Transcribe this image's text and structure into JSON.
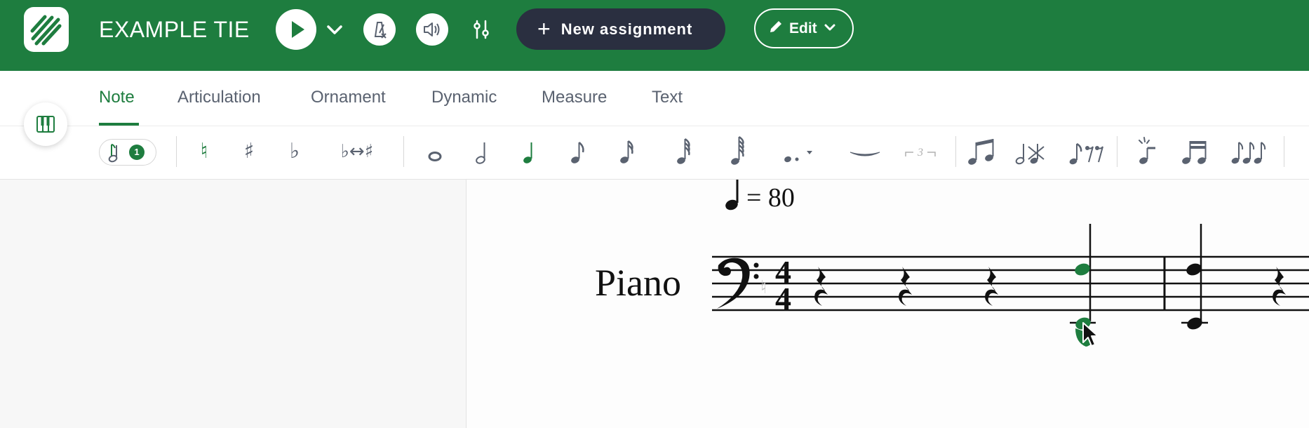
{
  "header": {
    "title": "EXAMPLE TIE",
    "new_assignment_label": "New assignment",
    "new_assignment_icon": "+",
    "edit_label": "Edit",
    "icons": [
      "app-logo-icon",
      "play-icon",
      "chevron-down-icon",
      "metronome-off-icon",
      "speaker-icon",
      "mixer-icon",
      "pencil-icon"
    ]
  },
  "tabs": [
    {
      "label": "Note",
      "active": true
    },
    {
      "label": "Articulation",
      "active": false
    },
    {
      "label": "Ornament",
      "active": false
    },
    {
      "label": "Dynamic",
      "active": false
    },
    {
      "label": "Measure",
      "active": false
    },
    {
      "label": "Text",
      "active": false
    }
  ],
  "toolbar": {
    "voice_badge": "1",
    "accidentals": [
      {
        "glyph": "♮",
        "name": "natural",
        "active": true
      },
      {
        "glyph": "♯",
        "name": "sharp",
        "active": false
      },
      {
        "glyph": "♭",
        "name": "flat",
        "active": false
      },
      {
        "glyph": "♭↔♯",
        "name": "enharmonic-swap",
        "active": false
      }
    ],
    "durations": [
      "whole",
      "half",
      "quarter",
      "eighth",
      "sixteenth",
      "thirty-second",
      "sixty-fourth"
    ],
    "active_duration": "quarter",
    "tuplet_label": "3",
    "extra_tools": [
      "dot",
      "tie",
      "tuplet",
      "beam",
      "no-beam",
      "rests",
      "grace-note",
      "beam-group",
      "flags"
    ]
  },
  "score": {
    "tempo_text": "= 80",
    "instrument": "Piano",
    "clef": "bass",
    "time_signature": {
      "numerator": "4",
      "denominator": "4"
    }
  },
  "colors": {
    "brand_green": "#1e7d3f",
    "dark_button": "#2a2f40",
    "icon_gray": "#5a6270"
  }
}
